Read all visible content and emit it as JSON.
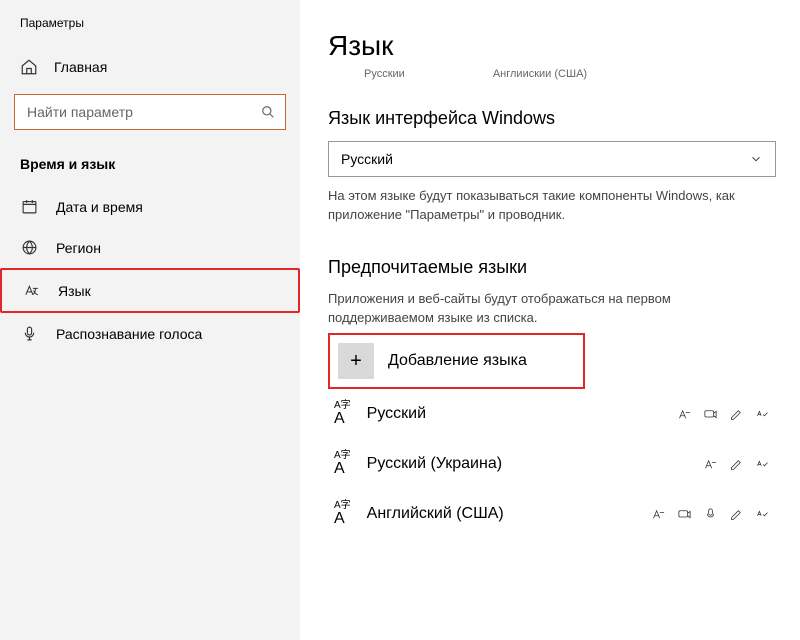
{
  "app_title": "Параметры",
  "sidebar": {
    "home": "Главная",
    "search_placeholder": "Найти параметр",
    "section": "Время и язык",
    "items": [
      {
        "label": "Дата и время"
      },
      {
        "label": "Регион"
      },
      {
        "label": "Язык"
      },
      {
        "label": "Распознавание голоса"
      }
    ]
  },
  "page": {
    "title": "Язык",
    "small_left": "Русскии",
    "small_right": "Англиискии (США)",
    "display_h": "Язык интерфейса Windows",
    "display_lang": "Русский",
    "display_desc": "На этом языке будут показываться такие компоненты Windows, как приложение \"Параметры\" и проводник.",
    "preferred_h": "Предпочитаемые языки",
    "preferred_desc": "Приложения и веб-сайты будут отображаться на первом поддерживаемом языке из списка.",
    "add_lang": "Добавление языка",
    "langs": [
      {
        "name": "Русский"
      },
      {
        "name": "Русский (Украина)"
      },
      {
        "name": "Английский (США)"
      }
    ]
  }
}
